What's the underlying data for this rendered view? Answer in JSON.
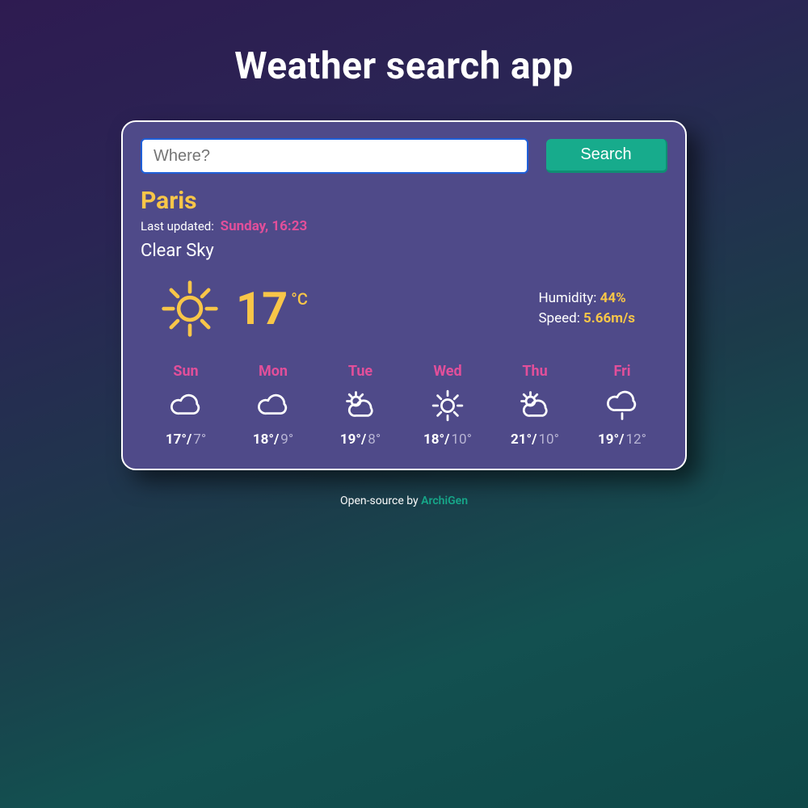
{
  "header": {
    "title": "Weather search app"
  },
  "search": {
    "placeholder": "Where?",
    "button_label": "Search"
  },
  "current": {
    "city": "Paris",
    "last_updated_label": "Last updated:",
    "last_updated_value": "Sunday, 16:23",
    "condition": "Clear Sky",
    "temperature": "17",
    "temperature_unit": "°C",
    "humidity_label": "Humidity:",
    "humidity_value": "44%",
    "wind_label": "Speed:",
    "wind_value": "5.66m/s",
    "icon": "sun"
  },
  "forecast": [
    {
      "day": "Sun",
      "icon": "cloud",
      "hi": "17°/",
      "lo": "7°"
    },
    {
      "day": "Mon",
      "icon": "cloud",
      "hi": "18°/",
      "lo": "9°"
    },
    {
      "day": "Tue",
      "icon": "sun-cloud",
      "hi": "19°/",
      "lo": "8°"
    },
    {
      "day": "Wed",
      "icon": "sun",
      "hi": "18°/",
      "lo": "10°"
    },
    {
      "day": "Thu",
      "icon": "sun-cloud",
      "hi": "21°/",
      "lo": "10°"
    },
    {
      "day": "Fri",
      "icon": "rain",
      "hi": "19°/",
      "lo": "12°"
    }
  ],
  "footer": {
    "text": "Open-source by ",
    "link_label": "ArchiGen"
  },
  "colors": {
    "accent_yellow": "#f8c648",
    "accent_pink": "#e24f9a",
    "accent_teal": "#17ab8c"
  }
}
